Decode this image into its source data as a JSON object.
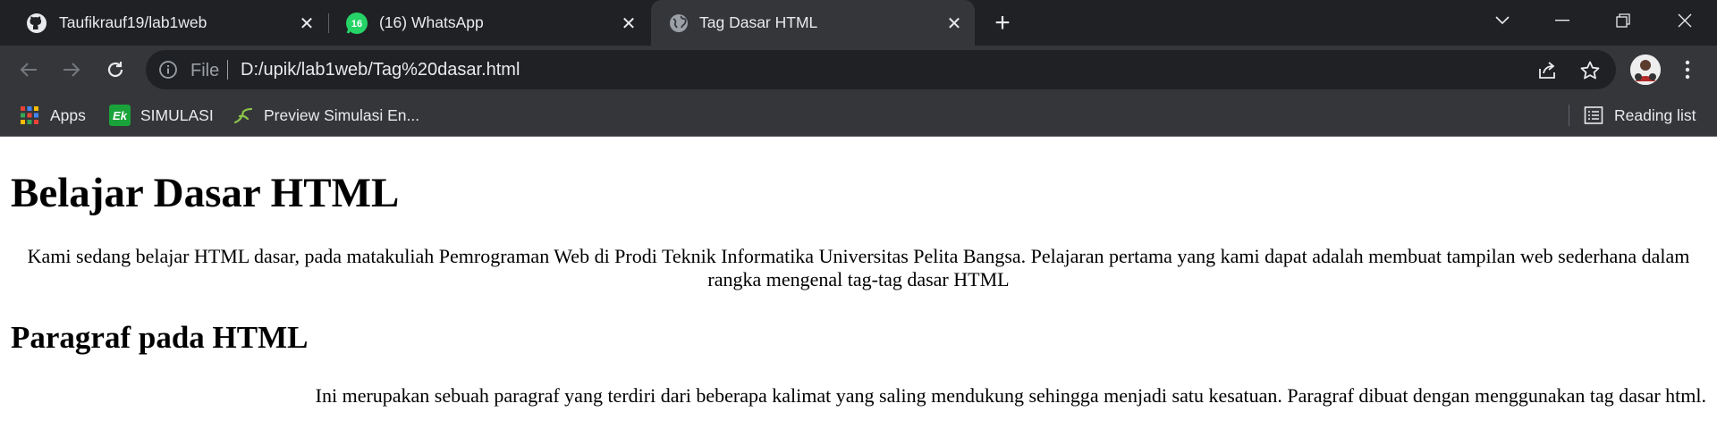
{
  "browser": {
    "tabs": [
      {
        "title": "Taufikrauf19/lab1web",
        "icon": "github-icon",
        "active": false
      },
      {
        "title": "(16) WhatsApp",
        "icon": "whatsapp-icon",
        "badge": "16",
        "active": false
      },
      {
        "title": "Tag Dasar HTML",
        "icon": "globe-icon",
        "active": true
      }
    ],
    "omnibox": {
      "scheme_label": "File",
      "url": "D:/upik/lab1web/Tag%20dasar.html"
    },
    "bookmarks": [
      {
        "label": "Apps",
        "icon": "apps-grid-icon"
      },
      {
        "label": "SIMULASI",
        "icon": "ek-logo-icon"
      },
      {
        "label": "Preview Simulasi En...",
        "icon": "leaf-icon"
      }
    ],
    "reading_list_label": "Reading list",
    "colors": {
      "frame": "#202124",
      "toolbar": "#35363a",
      "text": "#e8eaed",
      "whatsapp": "#25d366",
      "simulasi": "#1aa33a"
    }
  },
  "page": {
    "h1": "Belajar Dasar HTML",
    "intro": "Kami sedang belajar HTML dasar, pada matakuliah Pemrograman Web di Prodi Teknik Informatika Universitas Pelita Bangsa. Pelajaran pertama yang kami dapat adalah membuat tampilan web sederhana dalam rangka mengenal tag-tag dasar HTML",
    "h2": "Paragraf pada HTML",
    "paragraph": "Ini merupakan sebuah paragraf yang terdiri dari beberapa kalimat yang saling mendukung sehingga menjadi satu kesatuan. Paragraf dibuat dengan menggunakan tag dasar html."
  }
}
